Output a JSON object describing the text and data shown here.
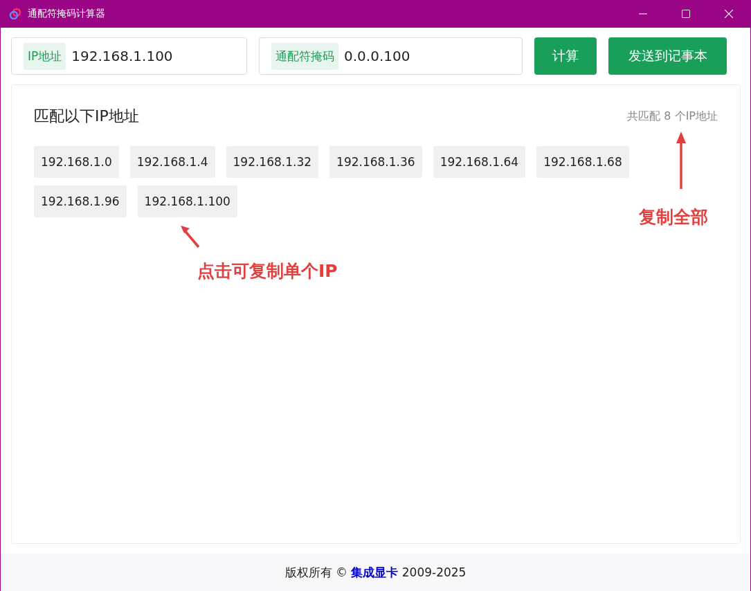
{
  "window": {
    "title": "通配符掩码计算器"
  },
  "inputs": [
    {
      "label": "IP地址",
      "value": "192.168.1.100"
    },
    {
      "label": "通配符掩码",
      "value": "0.0.0.100"
    }
  ],
  "buttons": [
    "计算",
    "发送到记事本"
  ],
  "results": {
    "heading": "匹配以下IP地址",
    "count": "共匹配 8 个IP地址",
    "ips": [
      "192.168.1.0",
      "192.168.1.4",
      "192.168.1.32",
      "192.168.1.36",
      "192.168.1.64",
      "192.168.1.68",
      "192.168.1.96",
      "192.168.1.100"
    ]
  },
  "annotations": [
    {
      "kind": "chips",
      "text": "点击可复制单个IP"
    },
    {
      "kind": "count",
      "text": "复制全部"
    }
  ],
  "footer": {
    "prefix": "版权所有 ©",
    "link": "集成显卡",
    "suffix": "2009-2025"
  }
}
